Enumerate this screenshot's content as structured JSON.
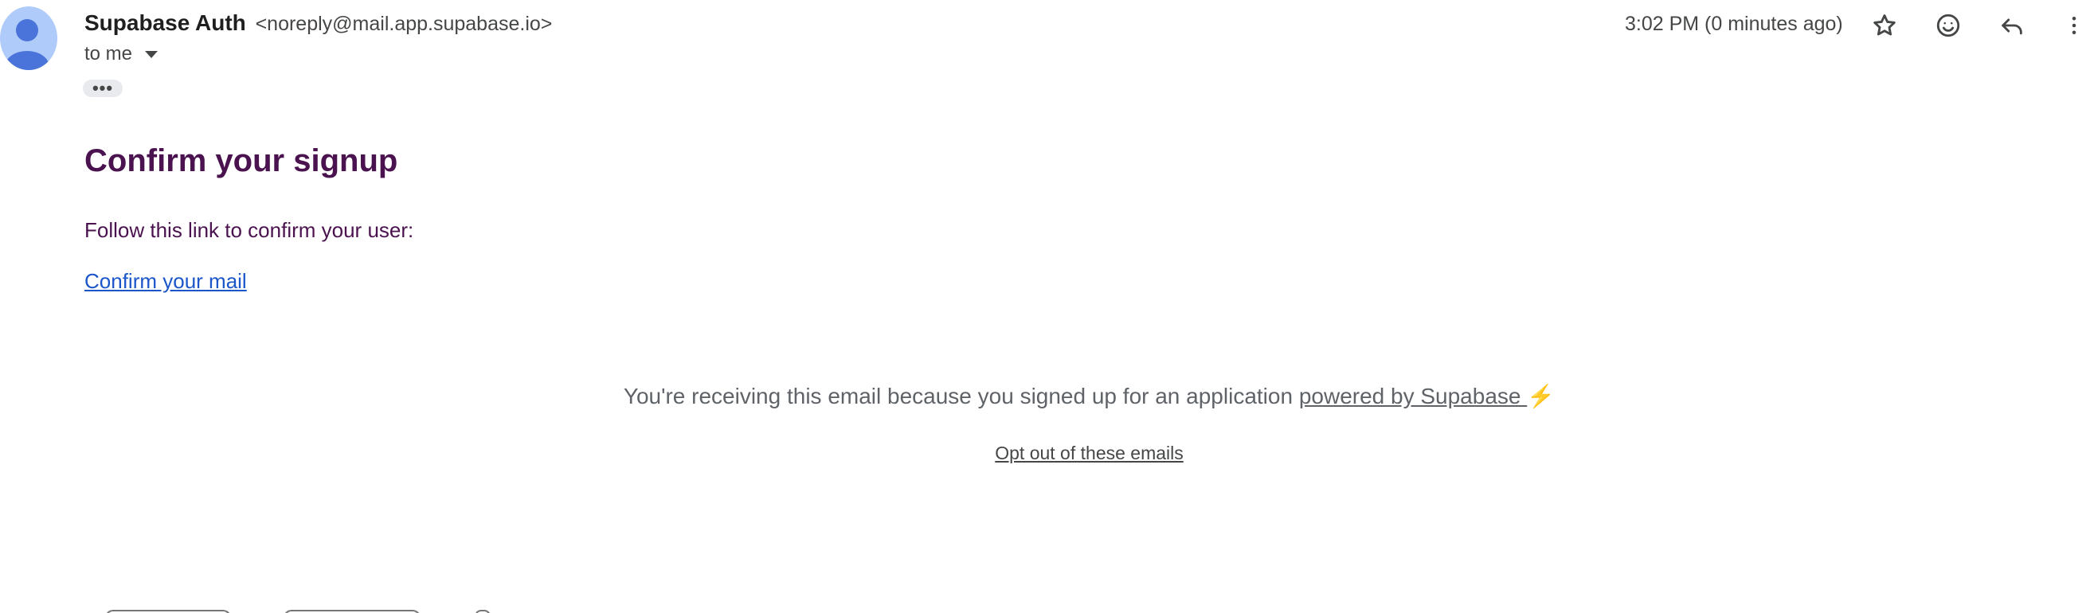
{
  "sender": {
    "name": "Supabase Auth",
    "email": "<noreply@mail.app.supabase.io>"
  },
  "recipient": {
    "label": "to me"
  },
  "more_content_label": "•••",
  "timestamp": "3:02 PM (0 minutes ago)",
  "header_actions": [
    {
      "icon": "star-icon"
    },
    {
      "icon": "emoji-icon"
    },
    {
      "icon": "reply-icon"
    },
    {
      "icon": "more-vert-icon"
    }
  ],
  "email_body": {
    "heading": "Confirm your signup",
    "instruction": "Follow this link to confirm your user:",
    "confirm_link_text": "Confirm your mail"
  },
  "footer": {
    "text_prefix": "You're receiving this email because you signed up for an application ",
    "powered_link_text": "powered by Supabase ",
    "bolt": "⚡",
    "optout_text": "Opt out of these emails"
  },
  "colors": {
    "heading": "#4a124e",
    "link": "#1a56c9",
    "avatar_bg": "#aecbfa",
    "avatar_fg": "#4a74d9"
  }
}
